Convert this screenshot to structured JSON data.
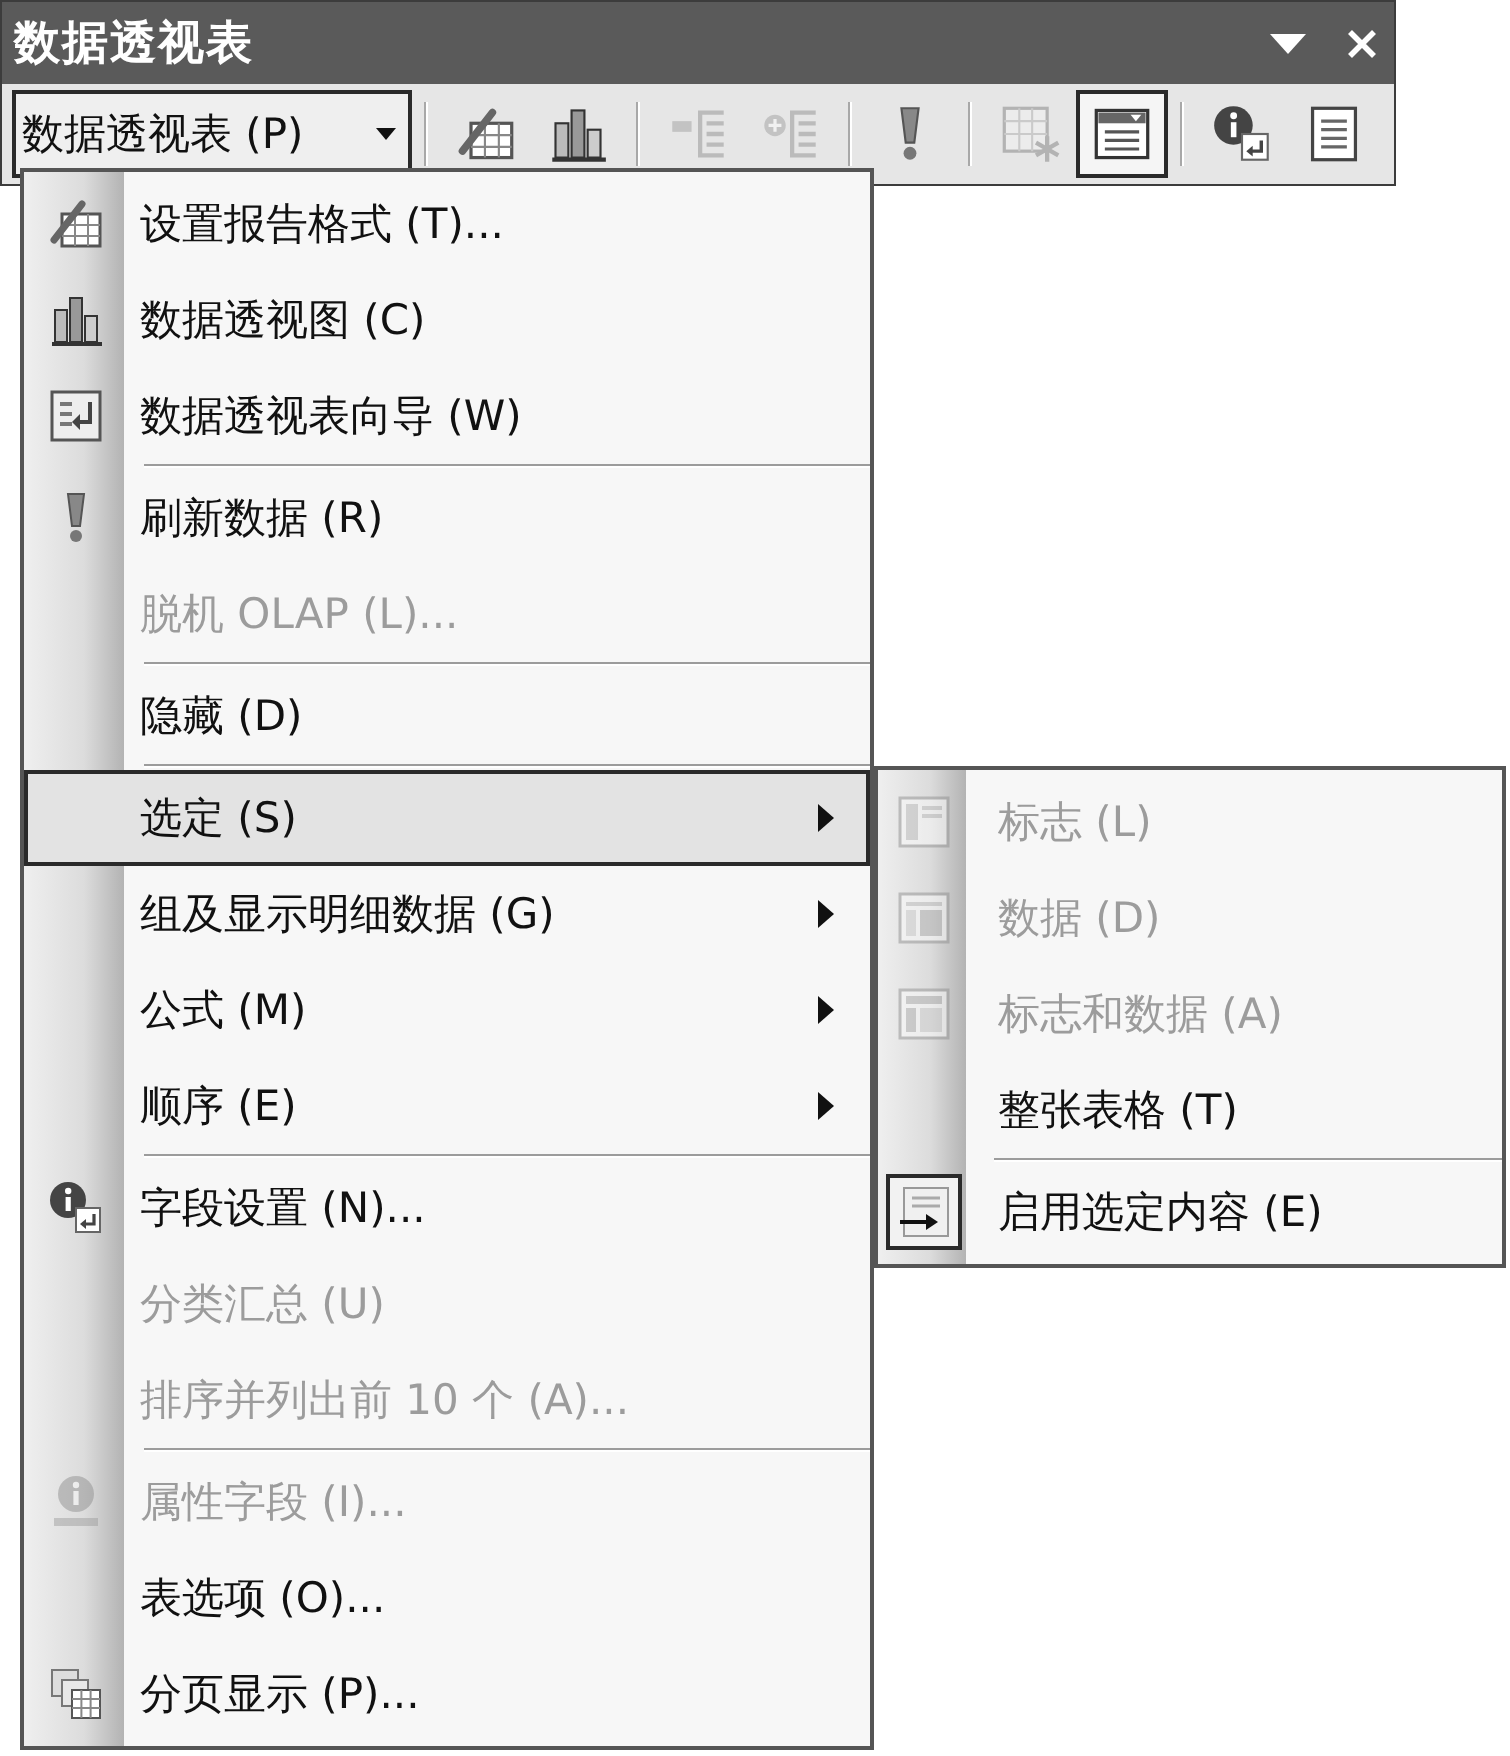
{
  "window": {
    "title": "数据透视表"
  },
  "toolbar": {
    "menu_button": {
      "label": "数据透视表 (P)",
      "expanded": true
    },
    "groups": [
      {
        "buttons": [
          {
            "disabled": false,
            "pressed": false
          },
          {
            "disabled": false,
            "pressed": false
          }
        ]
      },
      {
        "buttons": [
          {
            "disabled": true,
            "pressed": false
          },
          {
            "disabled": true,
            "pressed": false
          }
        ]
      },
      {
        "buttons": [
          {
            "disabled": false,
            "pressed": false
          }
        ]
      },
      {
        "buttons": [
          {
            "disabled": true,
            "pressed": false
          },
          {
            "disabled": false,
            "pressed": true
          }
        ]
      },
      {
        "buttons": [
          {
            "disabled": false,
            "pressed": false
          },
          {
            "disabled": false,
            "pressed": false
          }
        ]
      }
    ]
  },
  "menu": {
    "items": [
      {
        "kind": "command",
        "label": "设置报告格式 (T)...",
        "disabled": false,
        "selected": false
      },
      {
        "kind": "command",
        "label": "数据透视图 (C)",
        "disabled": false,
        "selected": false
      },
      {
        "kind": "command",
        "label": "数据透视表向导 (W)",
        "disabled": false,
        "selected": false
      },
      {
        "kind": "separator"
      },
      {
        "kind": "command",
        "label": "刷新数据 (R)",
        "disabled": false,
        "selected": false
      },
      {
        "kind": "command",
        "label": "脱机 OLAP (L)...",
        "disabled": true,
        "selected": false
      },
      {
        "kind": "separator"
      },
      {
        "kind": "command",
        "label": "隐藏 (D)",
        "disabled": false,
        "selected": false
      },
      {
        "kind": "separator"
      },
      {
        "kind": "submenu",
        "label": "选定 (S)",
        "disabled": false,
        "selected": true,
        "expanded": true,
        "submenu": {
          "items": [
            {
              "kind": "command",
              "label": "标志 (L)",
              "disabled": true,
              "selected": false,
              "checked": false
            },
            {
              "kind": "command",
              "label": "数据 (D)",
              "disabled": true,
              "selected": false,
              "checked": false
            },
            {
              "kind": "command",
              "label": "标志和数据 (A)",
              "disabled": true,
              "selected": false,
              "checked": false
            },
            {
              "kind": "command",
              "label": "整张表格 (T)",
              "disabled": false,
              "selected": false,
              "checked": false
            },
            {
              "kind": "separator"
            },
            {
              "kind": "command",
              "label": "启用选定内容 (E)",
              "disabled": false,
              "selected": false,
              "checked": true
            }
          ]
        }
      },
      {
        "kind": "submenu",
        "label": "组及显示明细数据 (G)",
        "disabled": false,
        "selected": false,
        "expanded": false
      },
      {
        "kind": "submenu",
        "label": "公式 (M)",
        "disabled": false,
        "selected": false,
        "expanded": false
      },
      {
        "kind": "submenu",
        "label": "顺序 (E)",
        "disabled": false,
        "selected": false,
        "expanded": false
      },
      {
        "kind": "separator"
      },
      {
        "kind": "command",
        "label": "字段设置 (N)...",
        "disabled": false,
        "selected": false
      },
      {
        "kind": "command",
        "label": "分类汇总 (U)",
        "disabled": true,
        "selected": false
      },
      {
        "kind": "command",
        "label": "排序并列出前 10 个 (A)...",
        "disabled": true,
        "selected": false
      },
      {
        "kind": "separator"
      },
      {
        "kind": "command",
        "label": "属性字段 (I)...",
        "disabled": true,
        "selected": false
      },
      {
        "kind": "command",
        "label": "表选项 (O)...",
        "disabled": false,
        "selected": false
      },
      {
        "kind": "command",
        "label": "分页显示 (P)...",
        "disabled": false,
        "selected": false
      }
    ]
  }
}
